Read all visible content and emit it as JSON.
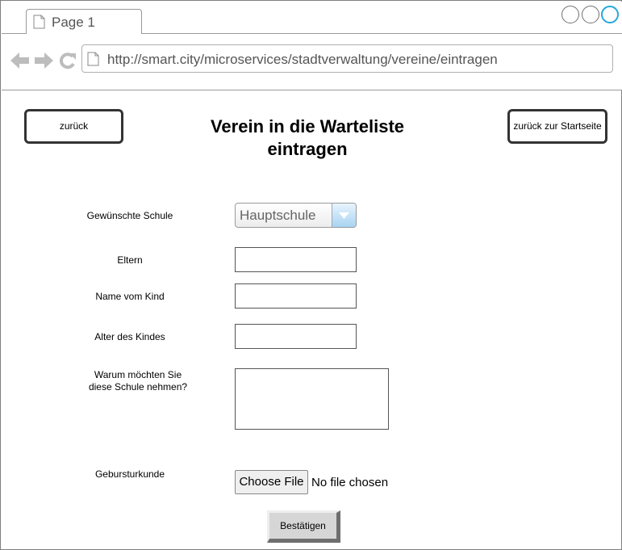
{
  "browser": {
    "tab_label": "Page 1",
    "url": "http://smart.city/microservices/stadtverwaltung/vereine/eintragen"
  },
  "header": {
    "back_label": "zurück",
    "home_label": "zurück zur Startseite",
    "title_line1": "Verein in die Warteliste",
    "title_line2": "eintragen"
  },
  "form": {
    "school_label": "Gewünschte Schule",
    "school_value": "Hauptschule",
    "parents_label": "Eltern",
    "parents_value": "",
    "child_name_label": "Name vom Kind",
    "child_name_value": "",
    "child_age_label": "Alter des Kindes",
    "child_age_value": "",
    "reason_label_line1": "Warum möchten Sie",
    "reason_label_line2": "diese Schule nehmen?",
    "reason_value": "",
    "birth_certificate_label": "Gebursturkunde",
    "file_button_label": "Choose File",
    "file_status": "No file chosen",
    "submit_label": "Bestätigen"
  }
}
